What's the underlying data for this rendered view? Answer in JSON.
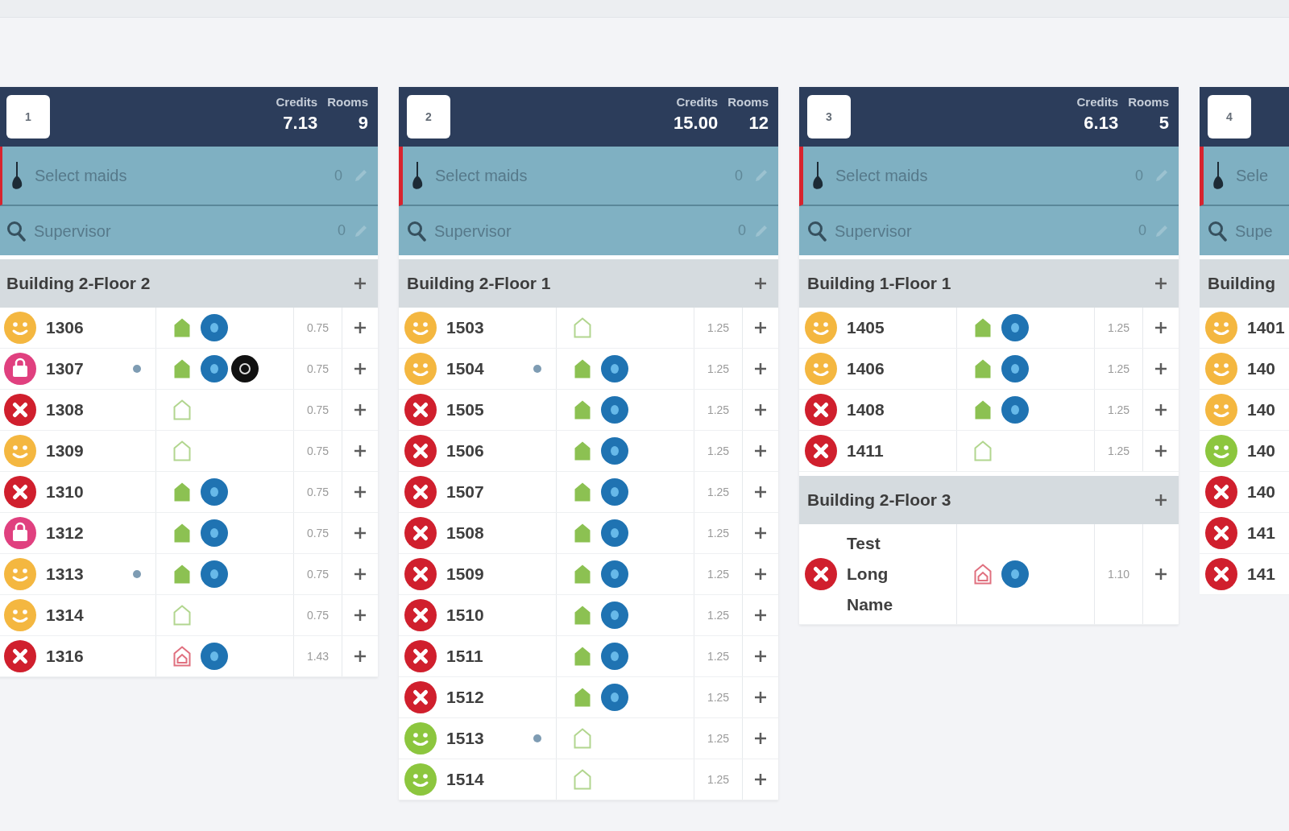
{
  "columns": [
    {
      "number": "1",
      "stats": [
        {
          "label": "Credits",
          "value": "7.13"
        },
        {
          "label": "Rooms",
          "value": "9"
        }
      ],
      "maids": {
        "placeholder": "Select maids",
        "count": "0"
      },
      "supervisor": {
        "placeholder": "Supervisor",
        "count": "0"
      },
      "sections": [
        {
          "title": "Building 2-Floor 2",
          "rooms": [
            {
              "number": "1306",
              "status": {
                "kind": "face",
                "color": "#f4b740"
              },
              "note_dot": false,
              "house": {
                "kind": "filled",
                "color": "#8cc152"
              },
              "info_badge": true,
              "dark_badge": false,
              "credits": "0.75"
            },
            {
              "number": "1307",
              "status": {
                "kind": "bag",
                "color": "#e0407f"
              },
              "note_dot": true,
              "house": {
                "kind": "filled",
                "color": "#8cc152"
              },
              "info_badge": true,
              "dark_badge": true,
              "credits": "0.75"
            },
            {
              "number": "1308",
              "status": {
                "kind": "cross",
                "color": "#d01f2d"
              },
              "note_dot": false,
              "house": {
                "kind": "outline",
                "color": "#b2d68f"
              },
              "info_badge": false,
              "dark_badge": false,
              "credits": "0.75"
            },
            {
              "number": "1309",
              "status": {
                "kind": "face",
                "color": "#f4b740"
              },
              "note_dot": false,
              "house": {
                "kind": "outline",
                "color": "#b2d68f"
              },
              "info_badge": false,
              "dark_badge": false,
              "credits": "0.75"
            },
            {
              "number": "1310",
              "status": {
                "kind": "cross",
                "color": "#d01f2d"
              },
              "note_dot": false,
              "house": {
                "kind": "filled",
                "color": "#8cc152"
              },
              "info_badge": true,
              "dark_badge": false,
              "credits": "0.75"
            },
            {
              "number": "1312",
              "status": {
                "kind": "bag",
                "color": "#e0407f"
              },
              "note_dot": false,
              "house": {
                "kind": "filled",
                "color": "#8cc152"
              },
              "info_badge": true,
              "dark_badge": false,
              "credits": "0.75"
            },
            {
              "number": "1313",
              "status": {
                "kind": "face",
                "color": "#f4b740"
              },
              "note_dot": true,
              "house": {
                "kind": "filled",
                "color": "#8cc152"
              },
              "info_badge": true,
              "dark_badge": false,
              "credits": "0.75"
            },
            {
              "number": "1314",
              "status": {
                "kind": "face",
                "color": "#f4b740"
              },
              "note_dot": false,
              "house": {
                "kind": "outline",
                "color": "#b2d68f"
              },
              "info_badge": false,
              "dark_badge": false,
              "credits": "0.75"
            },
            {
              "number": "1316",
              "status": {
                "kind": "cross",
                "color": "#d01f2d"
              },
              "note_dot": false,
              "house": {
                "kind": "marked",
                "color": "#e0707f"
              },
              "info_badge": true,
              "dark_badge": false,
              "credits": "1.43"
            }
          ]
        }
      ]
    },
    {
      "number": "2",
      "stats": [
        {
          "label": "Credits",
          "value": "15.00"
        },
        {
          "label": "Rooms",
          "value": "12"
        }
      ],
      "maids": {
        "placeholder": "Select maids",
        "count": "0"
      },
      "supervisor": {
        "placeholder": "Supervisor",
        "count": "0"
      },
      "sections": [
        {
          "title": "Building 2-Floor 1",
          "rooms": [
            {
              "number": "1503",
              "status": {
                "kind": "face",
                "color": "#f4b740"
              },
              "note_dot": false,
              "house": {
                "kind": "outline",
                "color": "#b2d68f"
              },
              "info_badge": false,
              "dark_badge": false,
              "credits": "1.25"
            },
            {
              "number": "1504",
              "status": {
                "kind": "face",
                "color": "#f4b740"
              },
              "note_dot": true,
              "house": {
                "kind": "filled",
                "color": "#8cc152"
              },
              "info_badge": true,
              "dark_badge": false,
              "credits": "1.25"
            },
            {
              "number": "1505",
              "status": {
                "kind": "cross",
                "color": "#d01f2d"
              },
              "note_dot": false,
              "house": {
                "kind": "filled",
                "color": "#8cc152"
              },
              "info_badge": true,
              "dark_badge": false,
              "credits": "1.25"
            },
            {
              "number": "1506",
              "status": {
                "kind": "cross",
                "color": "#d01f2d"
              },
              "note_dot": false,
              "house": {
                "kind": "filled",
                "color": "#8cc152"
              },
              "info_badge": true,
              "dark_badge": false,
              "credits": "1.25"
            },
            {
              "number": "1507",
              "status": {
                "kind": "cross",
                "color": "#d01f2d"
              },
              "note_dot": false,
              "house": {
                "kind": "filled",
                "color": "#8cc152"
              },
              "info_badge": true,
              "dark_badge": false,
              "credits": "1.25"
            },
            {
              "number": "1508",
              "status": {
                "kind": "cross",
                "color": "#d01f2d"
              },
              "note_dot": false,
              "house": {
                "kind": "filled",
                "color": "#8cc152"
              },
              "info_badge": true,
              "dark_badge": false,
              "credits": "1.25"
            },
            {
              "number": "1509",
              "status": {
                "kind": "cross",
                "color": "#d01f2d"
              },
              "note_dot": false,
              "house": {
                "kind": "filled",
                "color": "#8cc152"
              },
              "info_badge": true,
              "dark_badge": false,
              "credits": "1.25"
            },
            {
              "number": "1510",
              "status": {
                "kind": "cross",
                "color": "#d01f2d"
              },
              "note_dot": false,
              "house": {
                "kind": "filled",
                "color": "#8cc152"
              },
              "info_badge": true,
              "dark_badge": false,
              "credits": "1.25"
            },
            {
              "number": "1511",
              "status": {
                "kind": "cross",
                "color": "#d01f2d"
              },
              "note_dot": false,
              "house": {
                "kind": "filled",
                "color": "#8cc152"
              },
              "info_badge": true,
              "dark_badge": false,
              "credits": "1.25"
            },
            {
              "number": "1512",
              "status": {
                "kind": "cross",
                "color": "#d01f2d"
              },
              "note_dot": false,
              "house": {
                "kind": "filled",
                "color": "#8cc152"
              },
              "info_badge": true,
              "dark_badge": false,
              "credits": "1.25"
            },
            {
              "number": "1513",
              "status": {
                "kind": "face",
                "color": "#8cc63e"
              },
              "note_dot": true,
              "house": {
                "kind": "outline",
                "color": "#b2d68f"
              },
              "info_badge": false,
              "dark_badge": false,
              "credits": "1.25"
            },
            {
              "number": "1514",
              "status": {
                "kind": "face",
                "color": "#8cc63e"
              },
              "note_dot": false,
              "house": {
                "kind": "outline",
                "color": "#b2d68f"
              },
              "info_badge": false,
              "dark_badge": false,
              "credits": "1.25"
            }
          ]
        }
      ]
    },
    {
      "number": "3",
      "stats": [
        {
          "label": "Credits",
          "value": "6.13"
        },
        {
          "label": "Rooms",
          "value": "5"
        }
      ],
      "maids": {
        "placeholder": "Select maids",
        "count": "0"
      },
      "supervisor": {
        "placeholder": "Supervisor",
        "count": "0"
      },
      "sections": [
        {
          "title": "Building 1-Floor 1",
          "rooms": [
            {
              "number": "1405",
              "status": {
                "kind": "face",
                "color": "#f4b740"
              },
              "note_dot": false,
              "house": {
                "kind": "filled",
                "color": "#8cc152"
              },
              "info_badge": true,
              "dark_badge": false,
              "credits": "1.25"
            },
            {
              "number": "1406",
              "status": {
                "kind": "face",
                "color": "#f4b740"
              },
              "note_dot": false,
              "house": {
                "kind": "filled",
                "color": "#8cc152"
              },
              "info_badge": true,
              "dark_badge": false,
              "credits": "1.25"
            },
            {
              "number": "1408",
              "status": {
                "kind": "cross",
                "color": "#d01f2d"
              },
              "note_dot": false,
              "house": {
                "kind": "filled",
                "color": "#8cc152"
              },
              "info_badge": true,
              "dark_badge": false,
              "credits": "1.25"
            },
            {
              "number": "1411",
              "status": {
                "kind": "cross",
                "color": "#d01f2d"
              },
              "note_dot": false,
              "house": {
                "kind": "outline",
                "color": "#b2d68f"
              },
              "info_badge": false,
              "dark_badge": false,
              "credits": "1.25"
            }
          ]
        },
        {
          "title": "Building 2-Floor 3",
          "rooms": [
            {
              "number": "Test Long Name",
              "status": {
                "kind": "cross",
                "color": "#d01f2d"
              },
              "note_dot": false,
              "house": {
                "kind": "marked",
                "color": "#e0707f"
              },
              "info_badge": true,
              "dark_badge": false,
              "credits": "1.10"
            }
          ]
        }
      ]
    },
    {
      "number": "4",
      "maids": {
        "placeholder": "Sele"
      },
      "supervisor": {
        "placeholder": "Supe"
      },
      "sections": [
        {
          "title": "Building",
          "rooms": [
            {
              "number": "1401",
              "status": {
                "kind": "face",
                "color": "#f4b740"
              }
            },
            {
              "number": "140",
              "status": {
                "kind": "face",
                "color": "#f4b740"
              }
            },
            {
              "number": "140",
              "status": {
                "kind": "face",
                "color": "#f4b740"
              }
            },
            {
              "number": "140",
              "status": {
                "kind": "face",
                "color": "#8cc63e"
              }
            },
            {
              "number": "140",
              "status": {
                "kind": "cross",
                "color": "#d01f2d"
              }
            },
            {
              "number": "141",
              "status": {
                "kind": "cross",
                "color": "#d01f2d"
              }
            },
            {
              "number": "141",
              "status": {
                "kind": "cross",
                "color": "#d01f2d"
              }
            }
          ]
        }
      ]
    }
  ]
}
